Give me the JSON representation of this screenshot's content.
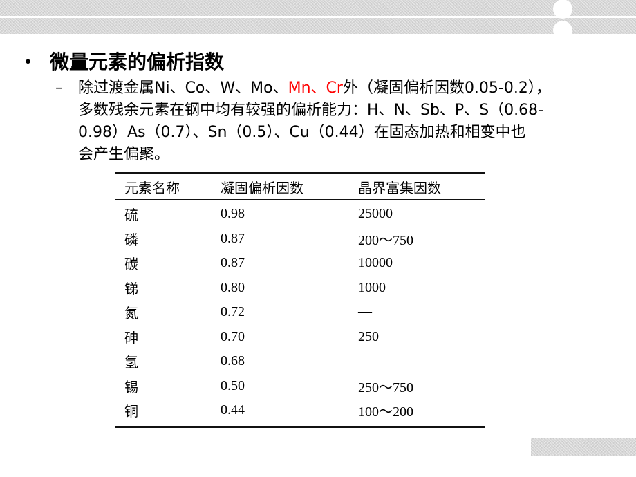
{
  "slide": {
    "title": "微量元素的偏析指数",
    "bullet_glyph": "•",
    "dash_glyph": "–",
    "body": {
      "line1_pre": "除过渡金属Ni、Co、W、Mo、",
      "line1_red": "Mn、Cr",
      "line1_post": "外（凝固偏析因数0.05-0.2），",
      "line2": "多数残余元素在钢中均有较强的偏析能力：H、N、Sb、P、S（0.68-",
      "line3": "0.98）As（0.7）、Sn（0.5）、Cu（0.44）在固态加热和相变中也",
      "line4": "会产生偏聚。"
    },
    "highlight_color": "#ff0000"
  },
  "table": {
    "headers": [
      "元素名称",
      "凝固偏析因数",
      "晶界富集因数"
    ],
    "rows": [
      [
        "硫",
        "0.98",
        "25000"
      ],
      [
        "磷",
        "0.87",
        "200～750"
      ],
      [
        "碳",
        "0.87",
        "10000"
      ],
      [
        "锑",
        "0.80",
        "1000"
      ],
      [
        "氮",
        "0.72",
        "—"
      ],
      [
        "砷",
        "0.70",
        "250"
      ],
      [
        "氢",
        "0.68",
        "—"
      ],
      [
        "锡",
        "0.50",
        "250～750"
      ],
      [
        "铜",
        "0.44",
        "100～200"
      ]
    ]
  }
}
